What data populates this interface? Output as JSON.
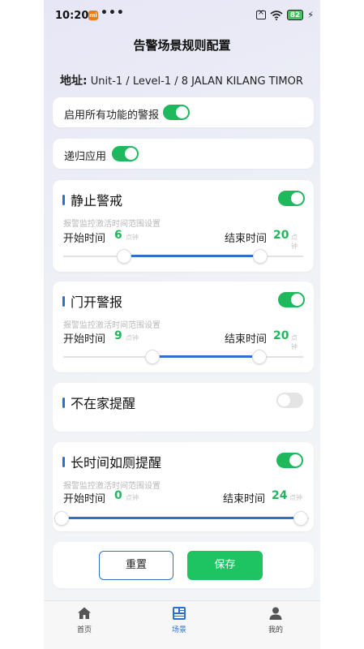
{
  "status_bar": {
    "time": "10:20",
    "battery": "82",
    "dots": "•••"
  },
  "page": {
    "title": "告警场景规则配置"
  },
  "address": {
    "label": "地址:",
    "value": "Unit-1 / Level-1 / 8 JALAN KILANG TIMOR"
  },
  "global": {
    "enable_all": {
      "label": "启用所有功能的警报",
      "on": true
    },
    "recursive": {
      "label": "递归应用",
      "on": true
    }
  },
  "sections": [
    {
      "title": "静止警戒",
      "enabled": true,
      "hint": "报警监控激活时间范围设置",
      "start_label": "开始时间",
      "start_value": "6",
      "start_unit": "点钟",
      "end_label": "结束时间",
      "end_value": "20",
      "end_unit": "点钟"
    },
    {
      "title": "门开警报",
      "enabled": true,
      "hint": "报警监控激活时间范围设置",
      "start_label": "开始时间",
      "start_value": "9",
      "start_unit": "点钟",
      "end_label": "结束时间",
      "end_value": "20",
      "end_unit": "点钟"
    },
    {
      "title": "不在家提醒",
      "enabled": false
    },
    {
      "title": "长时间如厕提醒",
      "enabled": true,
      "hint": "报警监控激活时间范围设置",
      "start_label": "开始时间",
      "start_value": "0",
      "start_unit": "点钟",
      "end_label": "结束时间",
      "end_value": "24",
      "end_unit": "点钟"
    }
  ],
  "actions": {
    "reset_label": "重置",
    "save_label": "保存"
  },
  "tabs": [
    {
      "label": "首页",
      "icon": "home-icon",
      "active": false
    },
    {
      "label": "场景",
      "icon": "scene-grid-icon",
      "active": true
    },
    {
      "label": "我的",
      "icon": "profile-icon",
      "active": false
    }
  ],
  "colors": {
    "accent_green": "#1fb85c",
    "accent_blue": "#2f6fd0",
    "save_button": "#1fc462"
  }
}
